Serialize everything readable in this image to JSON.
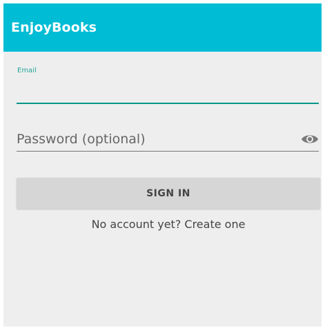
{
  "app": {
    "title": "EnjoyBooks"
  },
  "form": {
    "email": {
      "label": "Email",
      "value": ""
    },
    "password": {
      "placeholder": "Password (optional)",
      "value": "",
      "toggle_icon": "eye-icon"
    },
    "sign_in_label": "SIGN IN",
    "create_account_label": "No account yet? Create one"
  },
  "colors": {
    "app_bar": "#00bcd4",
    "accent": "#009688",
    "background": "#eeeeee",
    "button": "#d6d6d6"
  }
}
